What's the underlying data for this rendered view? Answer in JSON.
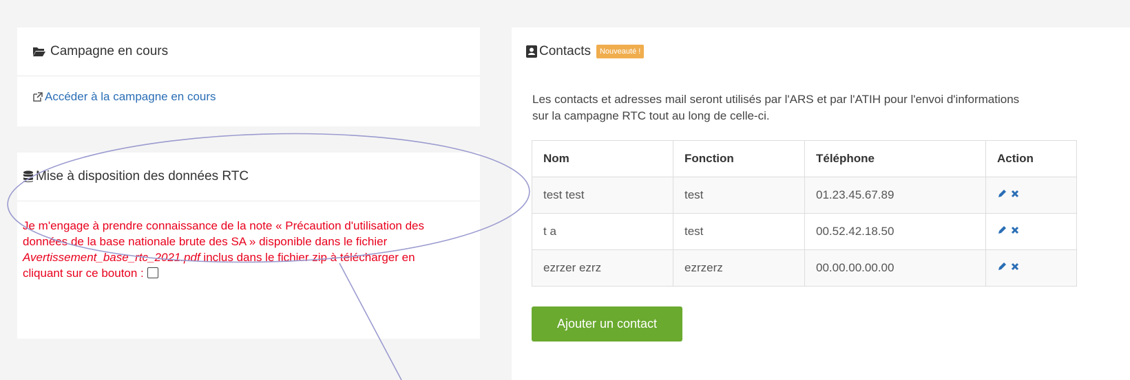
{
  "colors": {
    "link": "#2a6eb5",
    "warning_text": "#e8001c",
    "badge": "#f0ad4e",
    "add_button": "#6aaa2f",
    "annotation": "#9b9bd0"
  },
  "campaign_panel": {
    "icon": "folder-open-icon",
    "title": "Campagne en cours",
    "link_icon": "external-link-icon",
    "link_label": "Accéder à la campagne en cours"
  },
  "data_panel": {
    "icon": "database-icon",
    "title": "Mise à disposition des données RTC",
    "notice_part1": "Je m'engage à prendre connaissance de la note « Précaution d'utilisation des données de la base nationale brute des SA » disponible dans le fichier ",
    "notice_file": "Avertissement_base_rtc_2021.pdf",
    "notice_part2": " inclus dans le fichier zip à télécharger en cliquant sur ce bouton : ",
    "checkbox_checked": false
  },
  "contacts_panel": {
    "icon": "address-book-icon",
    "title": "Contacts",
    "badge": "Nouveauté !",
    "description": "Les contacts et adresses mail seront utilisés par l'ARS et par l'ATIH pour l'envoi d'informations sur la campagne RTC tout au long de celle-ci.",
    "columns": [
      "Nom",
      "Fonction",
      "Téléphone",
      "Action"
    ],
    "rows": [
      {
        "nom": "test test",
        "fonction": "test",
        "telephone": "01.23.45.67.89"
      },
      {
        "nom": "t a",
        "fonction": "test",
        "telephone": "00.52.42.18.50"
      },
      {
        "nom": "ezrzer ezrz",
        "fonction": "ezrzerz",
        "telephone": "00.00.00.00.00"
      }
    ],
    "action_icons": [
      "pencil-icon",
      "times-icon"
    ],
    "add_button": "Ajouter un contact"
  }
}
